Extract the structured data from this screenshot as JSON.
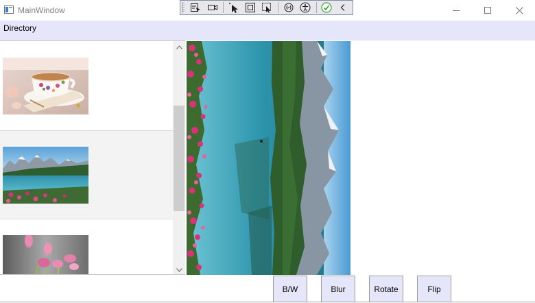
{
  "window": {
    "title": "MainWindow",
    "controls": {
      "minimize": "minimize",
      "maximize": "maximize",
      "close": "close"
    }
  },
  "debug_toolbar": {
    "items": [
      {
        "icon": "select-element-icon"
      },
      {
        "icon": "video-camera-icon"
      },
      {
        "icon": "pointer-icon"
      },
      {
        "icon": "display-layout-adorners-icon"
      },
      {
        "icon": "track-focused-element-icon"
      },
      {
        "icon": "binding-failures-icon"
      },
      {
        "icon": "accessibility-icon"
      },
      {
        "icon": "checkmark-icon"
      },
      {
        "icon": "collapse-chevron-icon"
      }
    ]
  },
  "menu": {
    "directory": "Directory"
  },
  "gallery": {
    "items": [
      {
        "name": "teacup",
        "selected": false
      },
      {
        "name": "mountain-lake",
        "selected": true
      },
      {
        "name": "tulips",
        "selected": false
      }
    ]
  },
  "preview": {
    "image": "mountain-lake-rotated"
  },
  "buttons": {
    "bw": "B/W",
    "blur": "Blur",
    "rotate": "Rotate",
    "flip": "Flip"
  },
  "colors": {
    "menu_bg": "#e6e6fa",
    "button_bg": "#e6e6fa",
    "selection_bg": "#f3f3f3"
  }
}
